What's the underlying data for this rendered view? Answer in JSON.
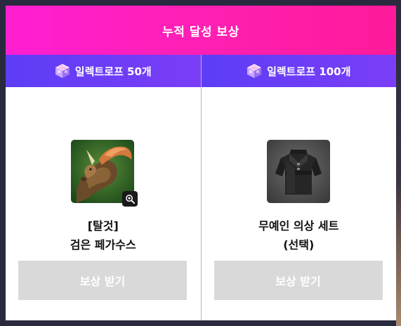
{
  "header": {
    "title": "누적 달성 보상"
  },
  "rewards": [
    {
      "currency_icon": "cube-icon",
      "requirement": "일렉트로프 50개",
      "item_icon": "pegasus-mount-icon",
      "name_line1": "[탈것]",
      "name_line2": "검은 페가수스",
      "button_label": "보상 받기",
      "zoom_icon": "zoom-in-icon"
    },
    {
      "currency_icon": "cube-icon",
      "requirement": "일렉트로프 100개",
      "item_icon": "costume-outfit-icon",
      "name_line1": "무예인 의상 세트",
      "name_line2": "(선택)",
      "button_label": "보상 받기"
    }
  ],
  "colors": {
    "header_gradient": [
      "#ff1fd2",
      "#ff1a9a"
    ],
    "subheader_gradient": [
      "#5d3df6",
      "#7b3df7"
    ],
    "button_disabled": "#d9d9d9"
  }
}
